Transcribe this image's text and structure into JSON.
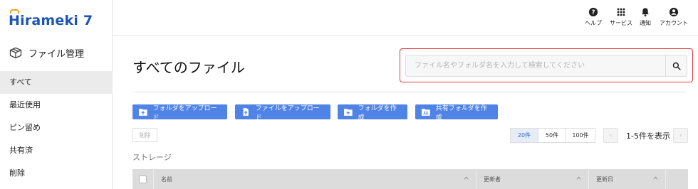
{
  "app": {
    "logo_text": "irameki 7",
    "logo_initial": "H",
    "section_title": "ファイル管理"
  },
  "sidebar": {
    "items": [
      {
        "label": "すべて",
        "active": true
      },
      {
        "label": "最近使用",
        "active": false
      },
      {
        "label": "ピン留め",
        "active": false
      },
      {
        "label": "共有済",
        "active": false
      },
      {
        "label": "削除",
        "active": false
      }
    ]
  },
  "topbar": {
    "items": [
      {
        "label": "ヘルプ",
        "icon": "help-icon"
      },
      {
        "label": "サービス",
        "icon": "apps-grid-icon"
      },
      {
        "label": "通知",
        "icon": "bell-icon"
      },
      {
        "label": "アカウント",
        "icon": "account-icon"
      }
    ]
  },
  "main": {
    "title": "すべてのファイル",
    "search": {
      "placeholder": "ファイル名やフォルダ名を入力して検索してください",
      "value": ""
    },
    "actions": [
      {
        "label": "フォルダをアップロード",
        "icon": "folder-upload-icon"
      },
      {
        "label": "ファイルをアップロード",
        "icon": "file-upload-icon"
      },
      {
        "label": "フォルダを作成",
        "icon": "folder-add-icon"
      },
      {
        "label": "共有フォルダを作成",
        "icon": "shared-folder-icon"
      }
    ],
    "delete_label": "削除",
    "pagination": {
      "sizes": [
        "20件",
        "50件",
        "100件"
      ],
      "selected": "20件",
      "range_text": "1-5件を表示"
    },
    "storage_label": "ストレージ",
    "table": {
      "columns": [
        "名前",
        "更新者",
        "更新日"
      ]
    }
  },
  "colors": {
    "brand": "#1e55b3",
    "accent": "#4f83e6",
    "highlight": "#e03a3a"
  }
}
